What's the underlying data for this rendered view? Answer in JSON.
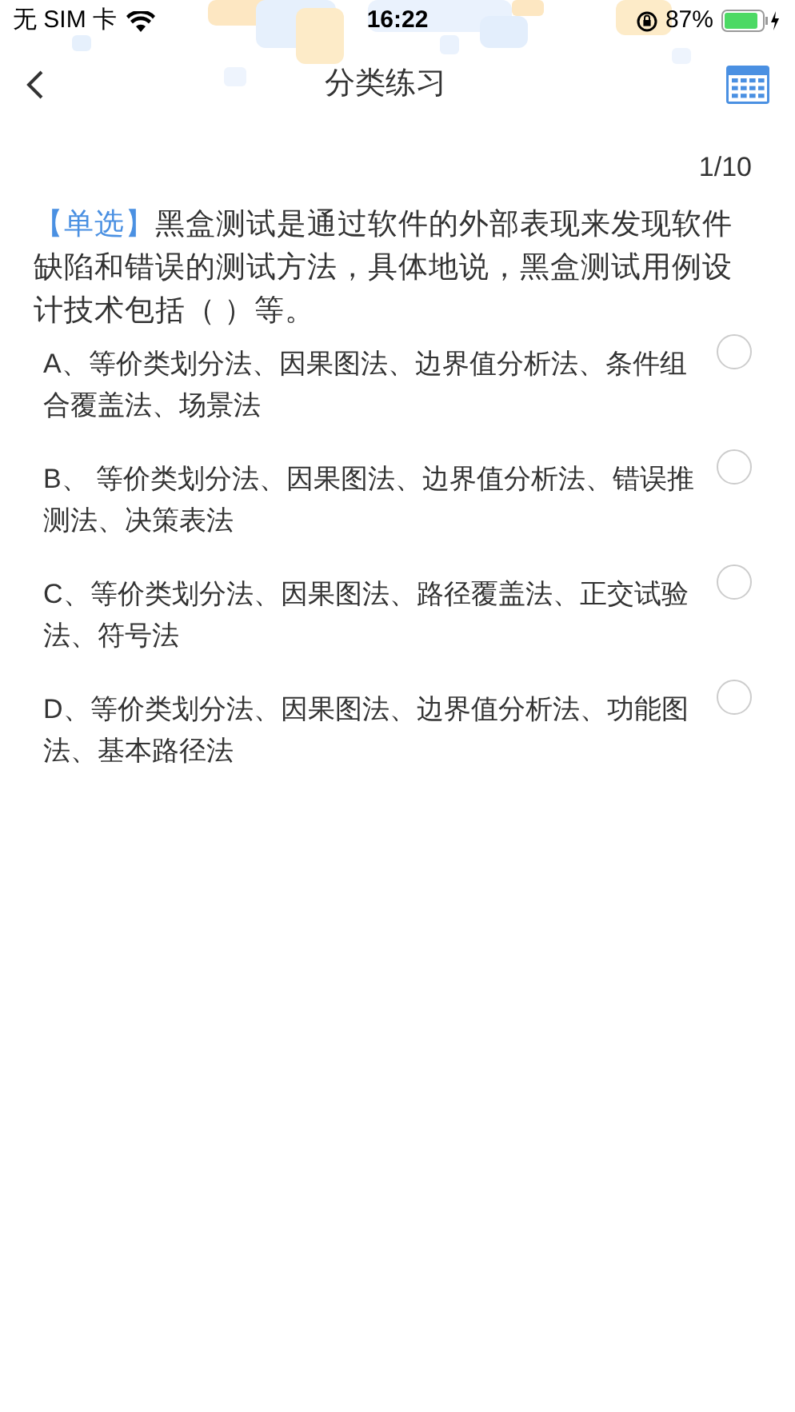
{
  "status_bar": {
    "carrier": "无 SIM 卡",
    "time": "16:22",
    "battery": "87%"
  },
  "nav": {
    "title": "分类练习"
  },
  "counter": "1/10",
  "question": {
    "type_tag": "【单选】",
    "text": "黑盒测试是通过软件的外部表现来发现软件缺陷和错误的测试方法，具体地说，黑盒测试用例设计技术包括（ ）等。"
  },
  "options": [
    {
      "text": "A、等价类划分法、因果图法、边界值分析法、条件组合覆盖法、场景法",
      "selected": false
    },
    {
      "text": "B、 等价类划分法、因果图法、边界值分析法、错误推测法、决策表法",
      "selected": false
    },
    {
      "text": "C、等价类划分法、因果图法、路径覆盖法、正交试验法、符号法",
      "selected": false
    },
    {
      "text": "D、等价类划分法、因果图法、边界值分析法、功能图法、基本路径法",
      "selected": false
    }
  ]
}
